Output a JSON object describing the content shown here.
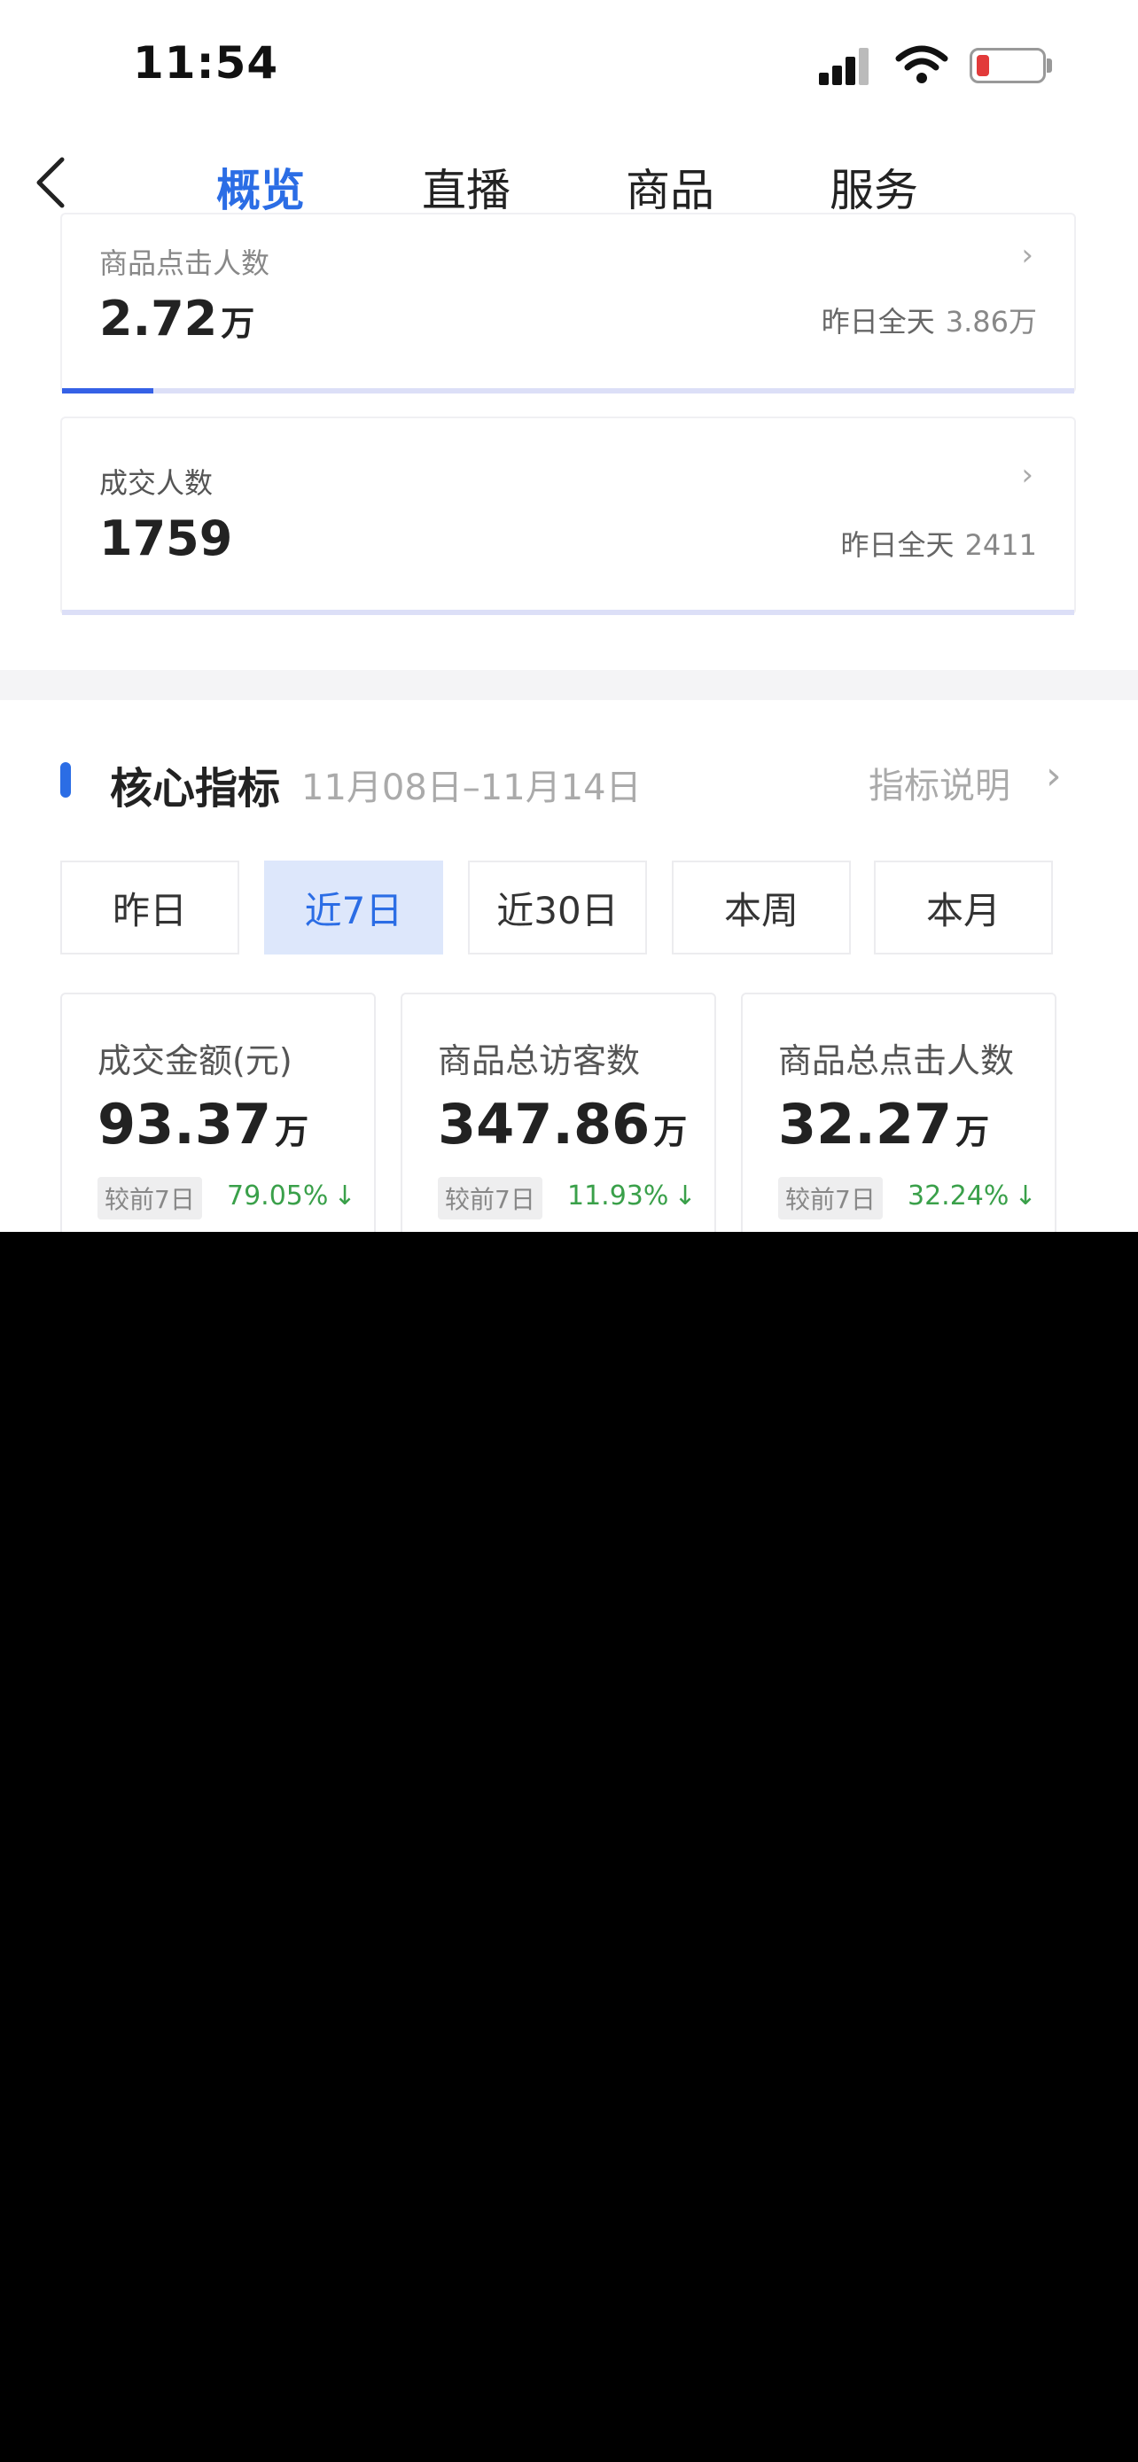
{
  "status_bar": {
    "time": "11:54"
  },
  "nav": {
    "tabs": [
      {
        "label": "概览",
        "active": true
      },
      {
        "label": "直播",
        "active": false
      },
      {
        "label": "商品",
        "active": false
      },
      {
        "label": "服务",
        "active": false
      }
    ]
  },
  "metric_cards": [
    {
      "label": "商品点击人数",
      "value": "2.72",
      "unit": "万",
      "compare_label": "昨日全天",
      "compare_value": "3.86万",
      "progress": 0.09
    },
    {
      "label": "成交人数",
      "value": "1759",
      "unit": "",
      "compare_label": "昨日全天",
      "compare_value": "2411",
      "progress": 0
    }
  ],
  "core_section": {
    "title": "核心指标",
    "date_range": "11月08日–11月14日",
    "help_link": "指标说明",
    "periods": [
      "昨日",
      "近7日",
      "近30日",
      "本周",
      "本月"
    ],
    "active_period": "近7日",
    "kpis": [
      {
        "label": "成交金额(元)",
        "value": "93.37",
        "unit": "万",
        "compare_label": "较前7日",
        "change": "79.05%",
        "direction": "down"
      },
      {
        "label": "商品总访客数",
        "value": "347.86",
        "unit": "万",
        "compare_label": "较前7日",
        "change": "11.93%",
        "direction": "down"
      },
      {
        "label": "商品总点击人数",
        "value": "32.27",
        "unit": "万",
        "compare_label": "较前7日",
        "change": "32.24%",
        "direction": "down"
      }
    ]
  },
  "colors": {
    "accent": "#2b6de5",
    "down": "#3aa04a",
    "battery_low": "#e23a3a"
  },
  "icons": [
    "back-chevron-icon",
    "cellular-signal-icon",
    "wifi-icon",
    "battery-icon",
    "chevron-right-icon",
    "arrow-down-icon"
  ]
}
